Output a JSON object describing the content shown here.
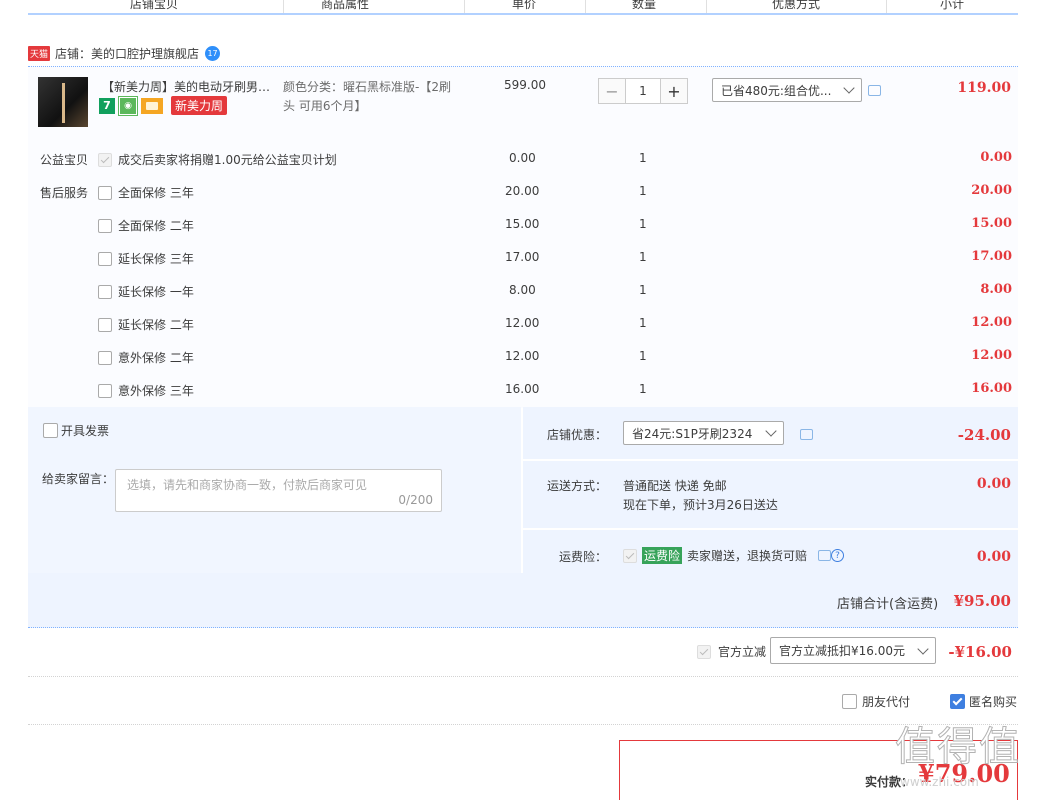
{
  "header": {
    "columns": [
      "店铺宝贝",
      "商品属性",
      "单价",
      "数量",
      "优惠方式",
      "小计"
    ]
  },
  "shop": {
    "badge": "天猫",
    "label": "店铺：美的口腔护理旗舰店",
    "im_badge": "17"
  },
  "product": {
    "title": "【新美力周】美的电动牙刷男女...",
    "badge_7": "7",
    "badge_promo": "新美力周",
    "spec_line1": "颜色分类：曜石黑标准版-【2刷",
    "spec_line2": "头 可用6个月】",
    "price": "599.00",
    "qty_minus": "−",
    "qty": "1",
    "qty_plus": "+",
    "discount_select": "已省480元:组合优...",
    "subtotal": "119.00"
  },
  "charity": {
    "label": "公益宝贝",
    "text": "成交后卖家将捐赠1.00元给公益宝贝计划",
    "price": "0.00",
    "qty": "1",
    "subtotal": "0.00"
  },
  "services_label": "售后服务",
  "services": [
    {
      "name": "全面保修 三年",
      "price": "20.00",
      "qty": "1",
      "subtotal": "20.00"
    },
    {
      "name": "全面保修 二年",
      "price": "15.00",
      "qty": "1",
      "subtotal": "15.00"
    },
    {
      "name": "延长保修 三年",
      "price": "17.00",
      "qty": "1",
      "subtotal": "17.00"
    },
    {
      "name": "延长保修 一年",
      "price": "8.00",
      "qty": "1",
      "subtotal": "8.00"
    },
    {
      "name": "延长保修 二年",
      "price": "12.00",
      "qty": "1",
      "subtotal": "12.00"
    },
    {
      "name": "意外保修 二年",
      "price": "12.00",
      "qty": "1",
      "subtotal": "12.00"
    },
    {
      "name": "意外保修 三年",
      "price": "16.00",
      "qty": "1",
      "subtotal": "16.00"
    }
  ],
  "invoice_label": "开具发票",
  "message": {
    "label": "给卖家留言：",
    "placeholder": "选填，请先和商家协商一致，付款后商家可见",
    "counter": "0/200"
  },
  "shop_discount": {
    "label": "店铺优惠：",
    "select": "省24元:S1P牙刷2324",
    "amount": "-24.00"
  },
  "shipping": {
    "label": "运送方式：",
    "line1": "普通配送 快递 免邮",
    "line2": "现在下单，预计3月26日送达",
    "amount": "0.00"
  },
  "freight_insurance": {
    "label": "运费险：",
    "tag": "运费险",
    "text": "卖家赠送，退换货可赔",
    "help": "?",
    "amount": "0.00"
  },
  "shop_total": {
    "label": "店铺合计(含运费)",
    "amount": "¥95.00"
  },
  "official": {
    "label": "官方立减",
    "select": "官方立减抵扣¥16.00元",
    "amount": "-¥16.00"
  },
  "options": {
    "friend_pay": "朋友代付",
    "anonymous": "匿名购买"
  },
  "payment": {
    "label": "实付款：",
    "amount": "¥79.00"
  },
  "watermark": {
    "text": "值得值",
    "url": "www.zhi.com"
  },
  "colors": {
    "accent_red": "#e4393c",
    "accent_blue": "#3e7fe0",
    "panel_blue": "#eef4ff"
  }
}
